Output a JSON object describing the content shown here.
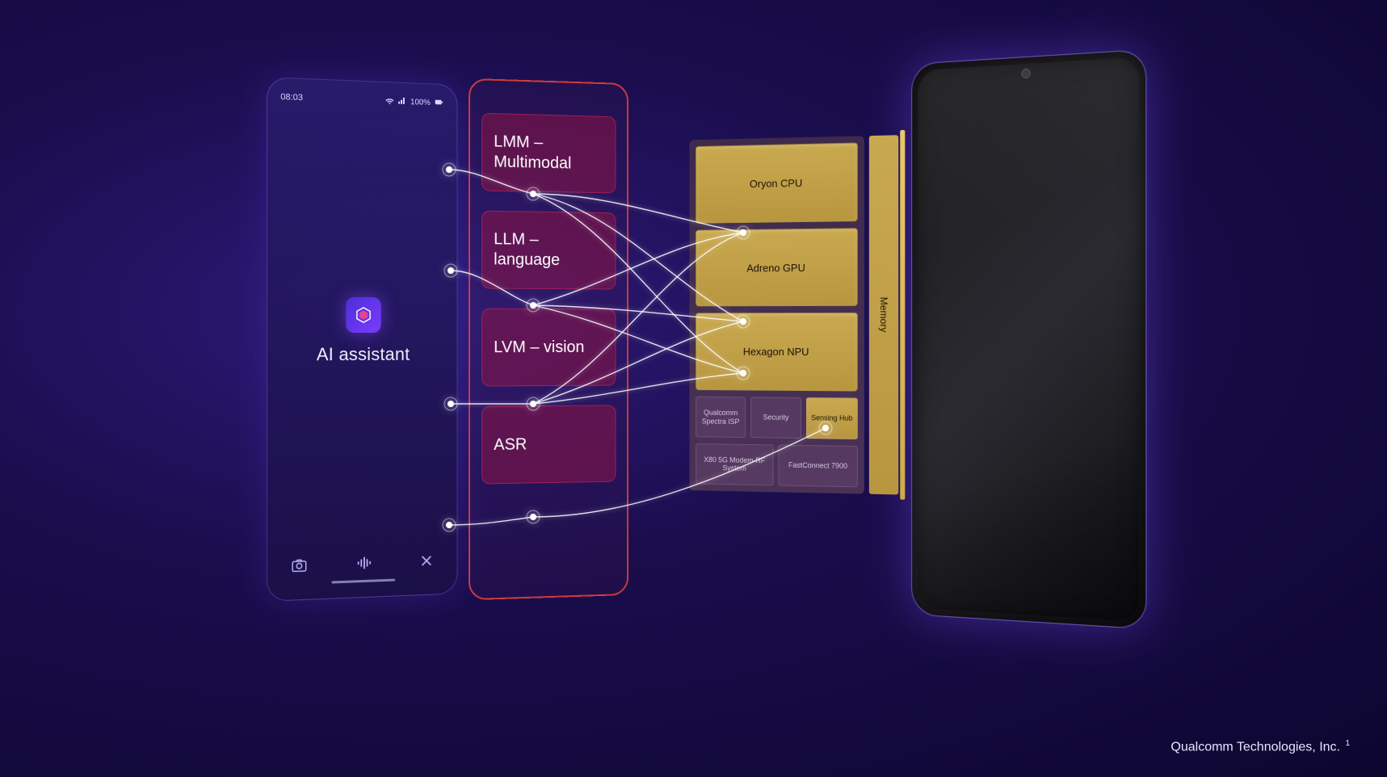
{
  "phone_ui": {
    "time": "08:03",
    "signal_label": "100%",
    "app_label": "AI assistant"
  },
  "models": [
    {
      "label": "LMM – Multimodal"
    },
    {
      "label": "LLM – language"
    },
    {
      "label": "LVM – vision"
    },
    {
      "label": "ASR"
    }
  ],
  "chip": {
    "processors": [
      "Oryon CPU",
      "Adreno GPU",
      "Hexagon NPU"
    ],
    "memory_label": "Memory",
    "subsystems_row1": [
      "Qualcomm Spectra ISP",
      "Security",
      "Sensing Hub"
    ],
    "subsystems_row2": [
      "X80 5G Modem-RF System",
      "FastConnect 7900"
    ]
  },
  "footer": {
    "text": "Qualcomm Technologies, Inc.",
    "note": "1"
  }
}
